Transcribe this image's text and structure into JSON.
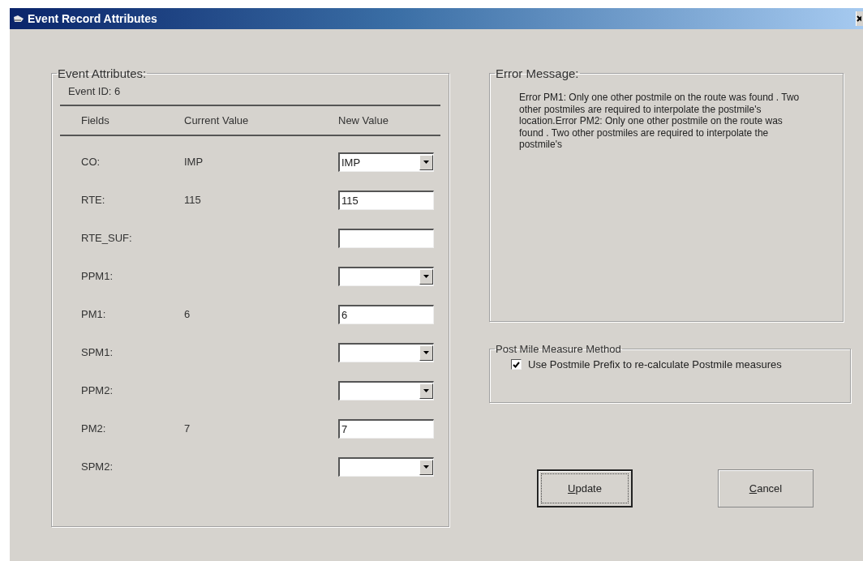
{
  "window": {
    "title": "Event Record Attributes"
  },
  "event_attributes": {
    "title": "Event Attributes:",
    "event_id": "Event ID: 6",
    "columns": [
      "Fields",
      "Current Value",
      "New Value"
    ],
    "rows": [
      {
        "field": "CO:",
        "current": "IMP",
        "kind": "combo",
        "new_value": "IMP"
      },
      {
        "field": "RTE:",
        "current": "115",
        "kind": "text",
        "new_value": "115"
      },
      {
        "field": "RTE_SUF:",
        "kind": "text"
      },
      {
        "field": "PPM1:",
        "kind": "combo"
      },
      {
        "field": "PM1:",
        "current": "6",
        "kind": "text",
        "new_value": "6"
      },
      {
        "field": "SPM1:",
        "kind": "combo"
      },
      {
        "field": "PPM2:",
        "kind": "combo"
      },
      {
        "field": "PM2:",
        "current": "7",
        "kind": "text",
        "new_value": "7"
      },
      {
        "field": "SPM2:",
        "kind": "combo"
      }
    ]
  },
  "error_message": {
    "title": "Error Message:",
    "text": "Error PM1: Only one other postmile on the route was found . Two other postmiles are required to interpolate the postmile's location.Error PM2: Only one other postmile on the route was found . Two other postmiles are required to interpolate the postmile's"
  },
  "post_mile_measure_method": {
    "title": "Post Mile Measure Method",
    "option": {
      "label": "Use Postmile Prefix to re-calculate Postmile measures",
      "checked": true
    }
  },
  "buttons": [
    {
      "label": "Update",
      "default": true
    },
    {
      "label": "Cancel",
      "default": false
    }
  ]
}
